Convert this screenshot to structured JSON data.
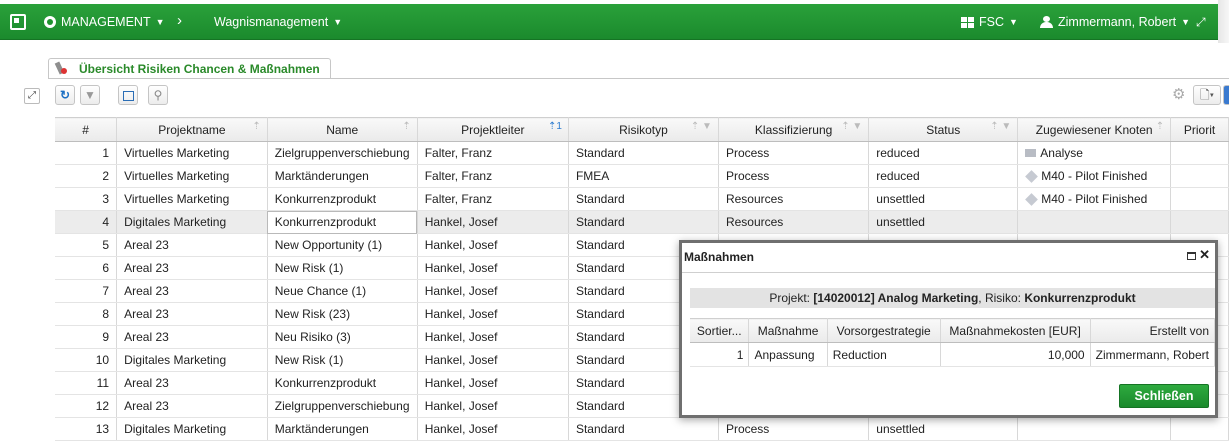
{
  "topbar": {
    "management_label": "MANAGEMENT",
    "breadcrumb_sep": "›",
    "module_label": "Wagnismanagement",
    "org_label": "FSC",
    "user_label": "Zimmermann, Robert",
    "brand_color": "#1f932f"
  },
  "tab": {
    "label": "Übersicht Risiken Chancen & Maßnahmen"
  },
  "toolbar": {
    "icons": [
      "refresh-icon",
      "filter-icon",
      "export-icon",
      "search-icon",
      "gear-icon",
      "document-icon"
    ]
  },
  "table": {
    "columns": [
      "#",
      "Projektname",
      "Name",
      "Projektleiter",
      "Risikotyp",
      "Klassifizierung",
      "Status",
      "Zugewiesener Knoten",
      "Priorit"
    ],
    "rows": [
      {
        "n": "1",
        "projekt": "Virtuelles Marketing",
        "name": "Zielgruppenverschiebung",
        "leiter": "Falter, Franz",
        "typ": "Standard",
        "klass": "Process",
        "status": "reduced",
        "knoten": "Analyse",
        "knoten_icon": "folder-icon"
      },
      {
        "n": "2",
        "projekt": "Virtuelles Marketing",
        "name": "Marktänderungen",
        "leiter": "Falter, Franz",
        "typ": "FMEA",
        "klass": "Process",
        "status": "reduced",
        "knoten": "M40 - Pilot Finished",
        "knoten_icon": "milestone-icon"
      },
      {
        "n": "3",
        "projekt": "Virtuelles Marketing",
        "name": "Konkurrenzprodukt",
        "leiter": "Falter, Franz",
        "typ": "Standard",
        "klass": "Resources",
        "status": "unsettled",
        "knoten": "M40 - Pilot Finished",
        "knoten_icon": "milestone-icon"
      },
      {
        "n": "4",
        "projekt": "Digitales Marketing",
        "name": "Konkurrenzprodukt",
        "leiter": "Hankel, Josef",
        "typ": "Standard",
        "klass": "Resources",
        "status": "unsettled",
        "knoten": "",
        "knoten_icon": ""
      },
      {
        "n": "5",
        "projekt": "Areal 23",
        "name": "New Opportunity (1)",
        "leiter": "Hankel, Josef",
        "typ": "Standard",
        "klass": "",
        "status": "",
        "knoten": "",
        "knoten_icon": ""
      },
      {
        "n": "6",
        "projekt": "Areal 23",
        "name": "New Risk (1)",
        "leiter": "Hankel, Josef",
        "typ": "Standard",
        "klass": "",
        "status": "",
        "knoten": "",
        "knoten_icon": ""
      },
      {
        "n": "7",
        "projekt": "Areal 23",
        "name": "Neue Chance (1)",
        "leiter": "Hankel, Josef",
        "typ": "Standard",
        "klass": "",
        "status": "",
        "knoten": "",
        "knoten_icon": ""
      },
      {
        "n": "8",
        "projekt": "Areal 23",
        "name": "New Risk (23)",
        "leiter": "Hankel, Josef",
        "typ": "Standard",
        "klass": "",
        "status": "",
        "knoten": "",
        "knoten_icon": ""
      },
      {
        "n": "9",
        "projekt": "Areal 23",
        "name": "Neu Risiko (3)",
        "leiter": "Hankel, Josef",
        "typ": "Standard",
        "klass": "",
        "status": "",
        "knoten": "",
        "knoten_icon": ""
      },
      {
        "n": "10",
        "projekt": "Digitales Marketing",
        "name": "New Risk (1)",
        "leiter": "Hankel, Josef",
        "typ": "Standard",
        "klass": "",
        "status": "",
        "knoten": "",
        "knoten_icon": ""
      },
      {
        "n": "11",
        "projekt": "Areal 23",
        "name": "Konkurrenzprodukt",
        "leiter": "Hankel, Josef",
        "typ": "Standard",
        "klass": "",
        "status": "",
        "knoten": "",
        "knoten_icon": ""
      },
      {
        "n": "12",
        "projekt": "Areal 23",
        "name": "Zielgruppenverschiebung",
        "leiter": "Hankel, Josef",
        "typ": "Standard",
        "klass": "",
        "status": "",
        "knoten": "",
        "knoten_icon": ""
      },
      {
        "n": "13",
        "projekt": "Digitales Marketing",
        "name": "Marktänderungen",
        "leiter": "Hankel, Josef",
        "typ": "Standard",
        "klass": "Process",
        "status": "unsettled",
        "knoten": "",
        "knoten_icon": ""
      }
    ]
  },
  "dialog": {
    "title": "Maßnahmen",
    "info_prefix": "Projekt: ",
    "info_project": "[14020012] Analog Marketing",
    "info_mid": ",  Risiko: ",
    "info_risk": "Konkurrenzprodukt",
    "columns": [
      "Sortier...",
      "Maßnahme",
      "Vorsorgestrategie",
      "Maßnahmekosten [EUR]",
      "Erstellt von"
    ],
    "rows": [
      {
        "sort": "1",
        "massnahme": "Anpassung",
        "strategie": "Reduction",
        "kosten": "10,000",
        "erstellt": "Zimmermann, Robert"
      }
    ],
    "close_label": "Schließen"
  }
}
